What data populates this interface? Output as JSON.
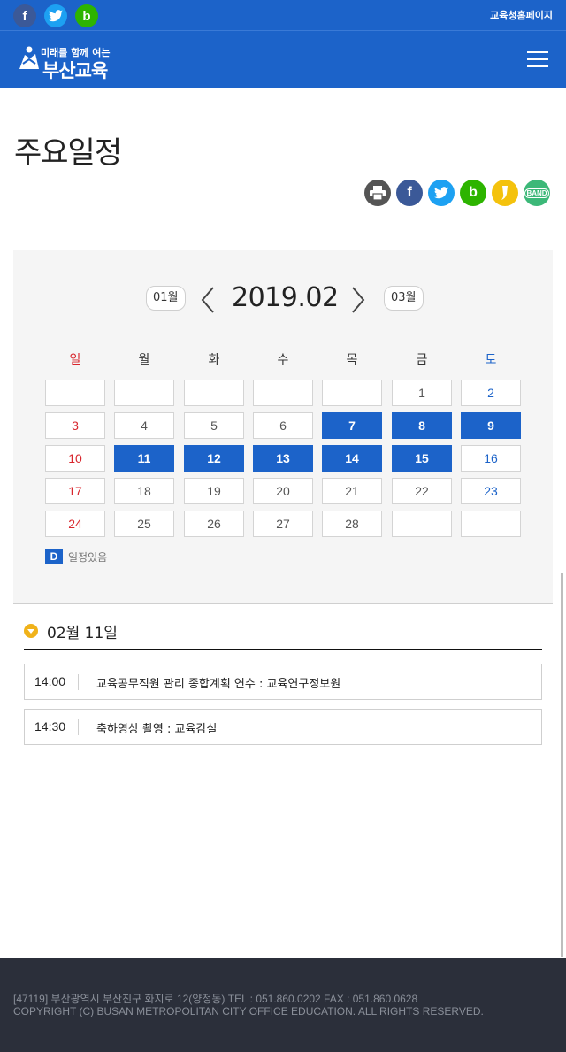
{
  "topbar": {
    "sns": [
      "facebook-icon",
      "twitter-icon",
      "blog-icon"
    ],
    "home_link": "교육청홈페이지"
  },
  "header": {
    "logo_small": "미래를 함께 여는",
    "logo_big": "부산교육"
  },
  "page": {
    "title": "주요일정"
  },
  "share_icons": [
    "print-icon",
    "facebook-icon",
    "twitter-icon",
    "blog-icon",
    "kakaostory-icon",
    "band-icon"
  ],
  "share_labels": {
    "band": "BAND"
  },
  "calendar": {
    "prev_label": "01월",
    "current": "2019.02",
    "next_label": "03월",
    "weekdays": [
      "일",
      "월",
      "화",
      "수",
      "목",
      "금",
      "토"
    ],
    "weeks": [
      [
        "",
        "",
        "",
        "",
        "",
        "1",
        "2"
      ],
      [
        "3",
        "4",
        "5",
        "6",
        "7",
        "8",
        "9"
      ],
      [
        "10",
        "11",
        "12",
        "13",
        "14",
        "15",
        "16"
      ],
      [
        "17",
        "18",
        "19",
        "20",
        "21",
        "22",
        "23"
      ],
      [
        "24",
        "25",
        "26",
        "27",
        "28",
        "",
        ""
      ]
    ],
    "event_days": [
      "7",
      "8",
      "9",
      "11",
      "12",
      "13",
      "14",
      "15"
    ],
    "legend_key": "D",
    "legend_text": "일정있음"
  },
  "selected_day": {
    "label": "02월 11일",
    "events": [
      {
        "time": "14:00",
        "desc": "교육공무직원 관리 종합계획 연수 : 교육연구정보원"
      },
      {
        "time": "14:30",
        "desc": "축하영상 촬영 : 교육감실"
      }
    ]
  },
  "footer": {
    "address": "[47119] 부산광역시 부산진구 화지로 12(양정동) TEL : 051.860.0202 FAX : 051.860.0628",
    "copyright": "COPYRIGHT (C) BUSAN METROPOLITAN CITY OFFICE EDUCATION. ALL RIGHTS RESERVED."
  },
  "colors": {
    "brand": "#1c63c9",
    "sunday": "#d8262d",
    "saturday": "#1c63c9",
    "footer_bg": "#2b2f3a",
    "accent": "#f0b21a"
  }
}
